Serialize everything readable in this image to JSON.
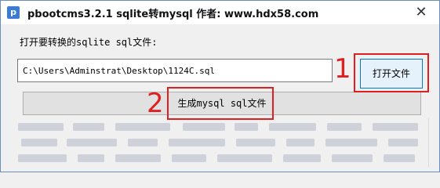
{
  "window": {
    "title": "pbootcms3.2.1 sqlite转mysql   作者: www.hdx58.com",
    "close_glyph": "✕",
    "app_icon_glyph": "p"
  },
  "main": {
    "prompt_label": "打开要转换的sqlite sql文件:",
    "file_path_value": "C:\\Users\\Adminstrat\\Desktop\\1124C.sql",
    "open_button_label": "打开文件",
    "generate_button_label": "生成mysql sql文件"
  },
  "annotations": {
    "marker_1": "1",
    "marker_2": "2",
    "color": "#e02020"
  },
  "colors": {
    "button_face": "#e1e1e1",
    "focused_button_border": "#0078d7",
    "window_border": "#6b8cbd"
  }
}
